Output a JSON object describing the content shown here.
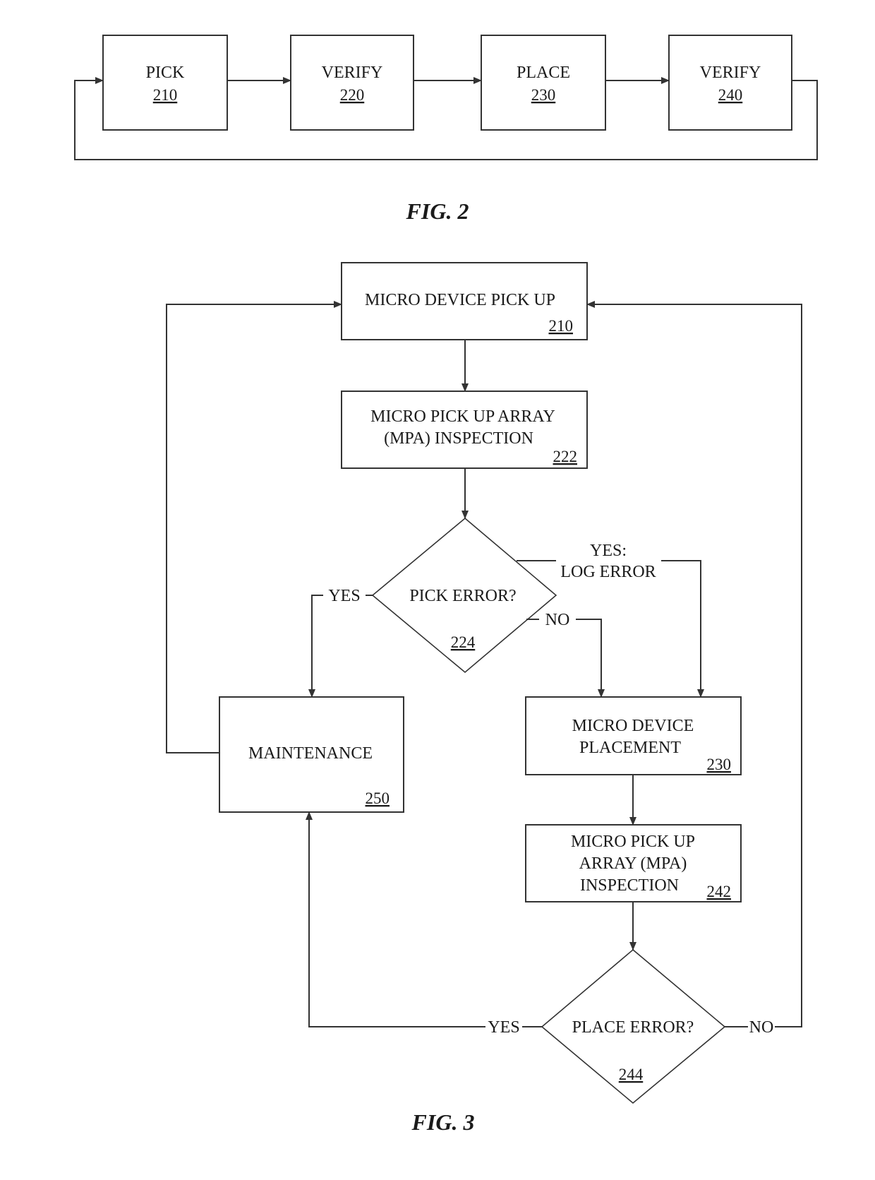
{
  "fig2": {
    "caption": "FIG. 2",
    "steps": [
      {
        "label": "PICK",
        "ref": "210"
      },
      {
        "label": "VERIFY",
        "ref": "220"
      },
      {
        "label": "PLACE",
        "ref": "230"
      },
      {
        "label": "VERIFY",
        "ref": "240"
      }
    ]
  },
  "fig3": {
    "caption": "FIG. 3",
    "pickup": {
      "label": "MICRO DEVICE PICK UP",
      "ref": "210"
    },
    "inspect1": {
      "lines": [
        "MICRO PICK UP ARRAY",
        "(MPA) INSPECTION"
      ],
      "ref": "222"
    },
    "pick_error": {
      "label": "PICK ERROR?",
      "ref": "224"
    },
    "maintenance": {
      "label": "MAINTENANCE",
      "ref": "250"
    },
    "placement": {
      "lines": [
        "MICRO DEVICE",
        "PLACEMENT"
      ],
      "ref": "230"
    },
    "inspect2": {
      "lines": [
        "MICRO PICK UP",
        "ARRAY (MPA)",
        "INSPECTION"
      ],
      "ref": "242"
    },
    "place_error": {
      "label": "PLACE ERROR?",
      "ref": "244"
    },
    "edges": {
      "pick_yes": "YES",
      "pick_no": "NO",
      "pick_yes_log_1": "YES:",
      "pick_yes_log_2": "LOG ERROR",
      "place_yes": "YES",
      "place_no": "NO"
    }
  }
}
